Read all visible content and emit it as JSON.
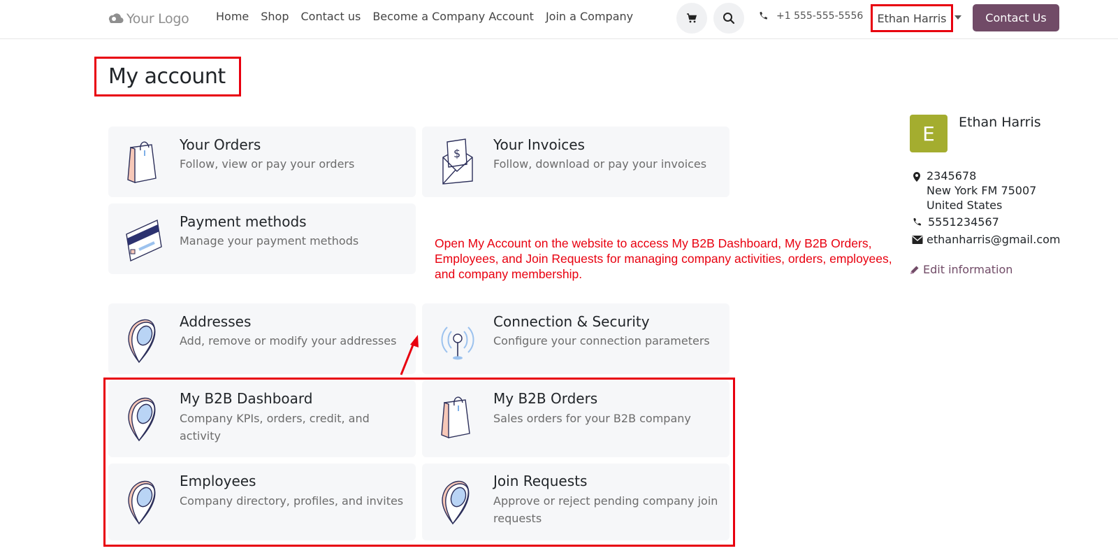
{
  "header": {
    "logo_text": "Your Logo",
    "nav": [
      "Home",
      "Shop",
      "Contact us",
      "Become a Company Account",
      "Join a Company"
    ],
    "phone": "+1 555-555-5556",
    "user_name": "Ethan Harris",
    "contact_button": "Contact Us"
  },
  "page": {
    "title": "My account"
  },
  "cards": [
    {
      "title": "Your Orders",
      "desc": "Follow, view or pay your orders",
      "icon": "shopping-bag-icon"
    },
    {
      "title": "Your Invoices",
      "desc": "Follow, download or pay your invoices",
      "icon": "invoice-envelope-icon"
    },
    {
      "title": "Payment methods",
      "desc": "Manage your payment methods",
      "icon": "credit-card-icon"
    },
    {
      "title": "Addresses",
      "desc": "Add, remove or modify your addresses",
      "icon": "map-pin-icon"
    },
    {
      "title": "Connection & Security",
      "desc": "Configure your connection parameters",
      "icon": "antenna-icon"
    },
    {
      "title": "My B2B Dashboard",
      "desc": "Company KPIs, orders, credit, and activity",
      "icon": "map-pin-icon"
    },
    {
      "title": "My B2B Orders",
      "desc": "Sales orders for your B2B company",
      "icon": "shopping-bag-icon"
    },
    {
      "title": "Employees",
      "desc": "Company directory, profiles, and invites",
      "icon": "map-pin-icon"
    },
    {
      "title": "Join Requests",
      "desc": "Approve or reject pending company join requests",
      "icon": "map-pin-icon"
    }
  ],
  "annotation": "Open My Account on the website to access My B2B Dashboard, My B2B Orders, Employees, and Join Requests for managing company activities, orders, employees, and company membership.",
  "profile": {
    "initial": "E",
    "name": "Ethan Harris",
    "address_line1": "2345678",
    "address_line2": "New York FM 75007",
    "address_line3": "United States",
    "phone": "5551234567",
    "email": "ethanharris@gmail.com",
    "edit_label": "Edit information"
  },
  "colors": {
    "brand": "#714b67",
    "annotation_red": "#e8000f",
    "avatar": "#a4ad2f",
    "card_bg": "#f6f7f9"
  }
}
